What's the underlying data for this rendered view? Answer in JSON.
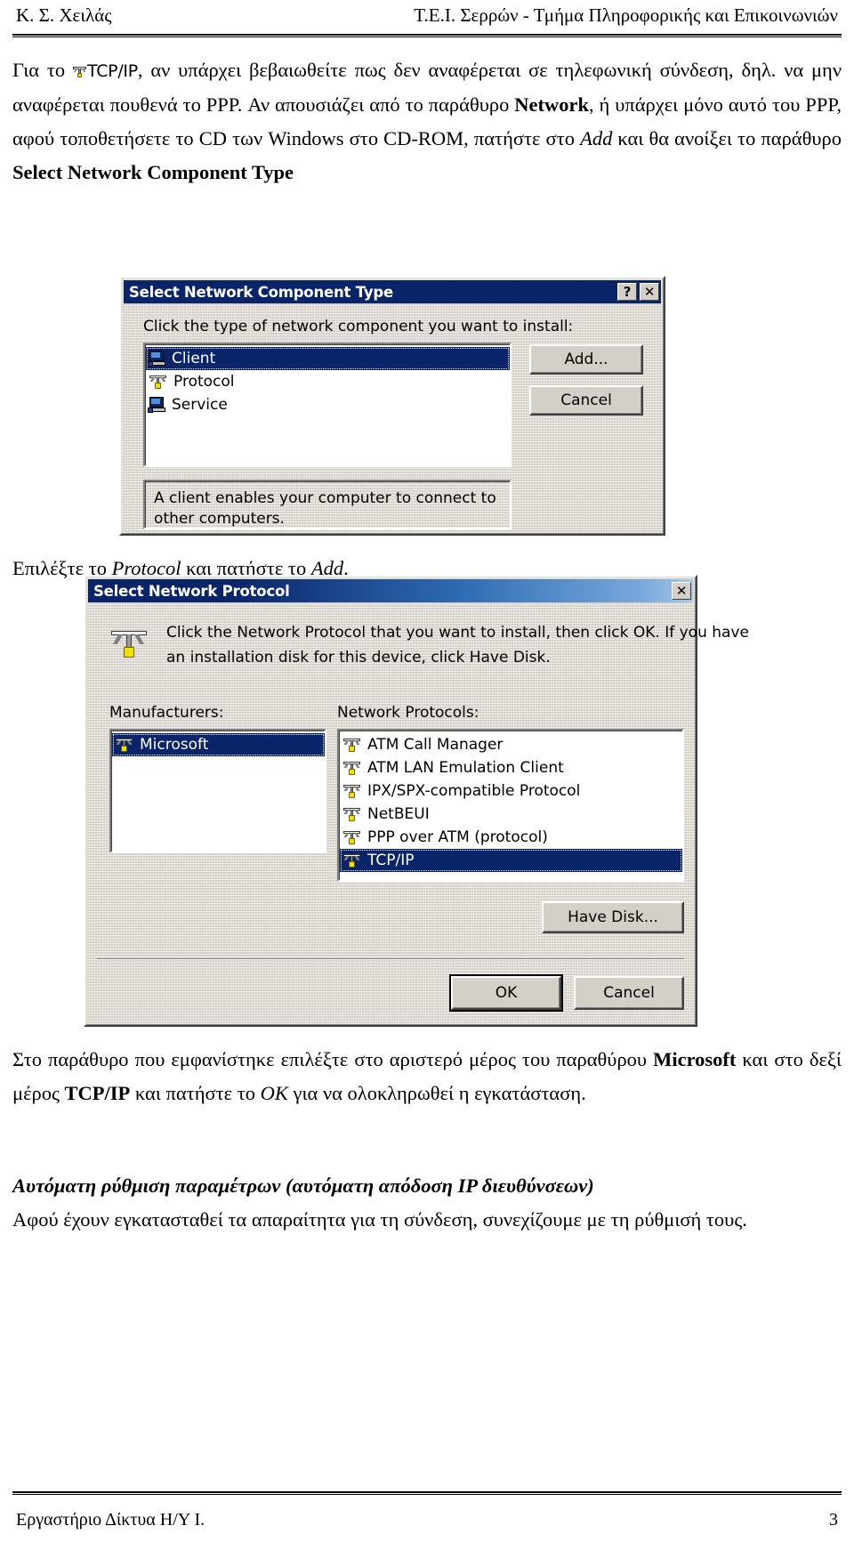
{
  "header": {
    "left": "Κ. Σ. Χειλάς",
    "right": "Τ.Ε.Ι. Σερρών - Τμήμα Πληροφορικής και Επικοινωνιών"
  },
  "body": {
    "para1": {
      "seg_a": "Για το ",
      "icon_label": "TCP/IP",
      "seg_b": ", αν υπάρχει βεβαιωθείτε πως δεν αναφέρεται σε τηλεφωνική σύνδεση, δηλ. να μην αναφέρεται πουθενά το PPP. Αν απουσιάζει από το παράθυρο ",
      "seg_c_bold": "Network",
      "seg_d": ", ή υπάρχει μόνο αυτό του PPP,  αφού τοποθετήσετε το CD των Windows στο CD-ROM, πατήστε στο ",
      "seg_e_italic": "Add",
      "seg_f": " και θα ανοίξει το παράθυρο ",
      "seg_g_bold": "Select Network Component Type"
    },
    "para2": {
      "seg_a": "Επιλέξτε το ",
      "seg_b_italic": "Protocol",
      "seg_c": " και πατήστε το ",
      "seg_d_italic": "Add",
      "seg_e": "."
    },
    "para3": {
      "seg_a": "Στο παράθυρο που εμφανίστηκε επιλέξτε στο αριστερό μέρος του παραθύρου ",
      "seg_b_bold": "Microsoft",
      "seg_c": " και στο δεξί μέρος ",
      "seg_d_bold": "TCP/IP",
      "seg_e": " και πατήστε το ",
      "seg_f_italic": "OK",
      "seg_g": " για να ολοκληρωθεί η εγκατάσταση."
    },
    "heading1": "Αυτόματη ρύθμιση παραμέτρων (αυτόματη απόδοση IP διευθύνσεων)",
    "para4": "Αφού έχουν εγκατασταθεί τα απαραίτητα για τη σύνδεση, συνεχίζουμε με τη ρύθμισή τους."
  },
  "dialog1": {
    "title": "Select Network Component Type",
    "help_button": "?",
    "close_button": "✕",
    "prompt": "Click the type of network component you want to install:",
    "list": [
      {
        "label": "Client",
        "icon": "computer-icon",
        "selected": true
      },
      {
        "label": "Protocol",
        "icon": "protocol-icon",
        "selected": false
      },
      {
        "label": "Service",
        "icon": "computer-icon",
        "selected": false
      }
    ],
    "description": "A client enables your computer to connect to other computers.",
    "buttons": {
      "add": "Add...",
      "cancel": "Cancel"
    }
  },
  "dialog2": {
    "title": "Select Network Protocol",
    "close_button": "✕",
    "prompt_line1": "Click the Network Protocol that you want to install, then click OK. If you have",
    "prompt_line2": "an installation disk for this device, click Have Disk.",
    "manufacturers_label": "Manufacturers:",
    "protocols_label": "Network Protocols:",
    "manufacturers": [
      {
        "label": "Microsoft",
        "icon": "protocol-icon",
        "selected": true
      }
    ],
    "protocols": [
      {
        "label": "ATM Call Manager",
        "icon": "protocol-icon",
        "selected": false
      },
      {
        "label": "ATM LAN Emulation Client",
        "icon": "protocol-icon",
        "selected": false
      },
      {
        "label": "IPX/SPX-compatible Protocol",
        "icon": "protocol-icon",
        "selected": false
      },
      {
        "label": "NetBEUI",
        "icon": "protocol-icon",
        "selected": false
      },
      {
        "label": "PPP over ATM (protocol)",
        "icon": "protocol-icon",
        "selected": false
      },
      {
        "label": "TCP/IP",
        "icon": "protocol-icon",
        "selected": true
      }
    ],
    "buttons": {
      "have_disk": "Have Disk...",
      "ok": "OK",
      "cancel": "Cancel"
    }
  },
  "footer": {
    "left": "Εργαστήριο Δίκτυα Η/Υ Ι.",
    "page": "3"
  },
  "colors": {
    "title_active": "#0a246a",
    "dialog_face": "#d4d0c8",
    "selection": "#0a246a",
    "icon_yellow": "#f2e000"
  }
}
